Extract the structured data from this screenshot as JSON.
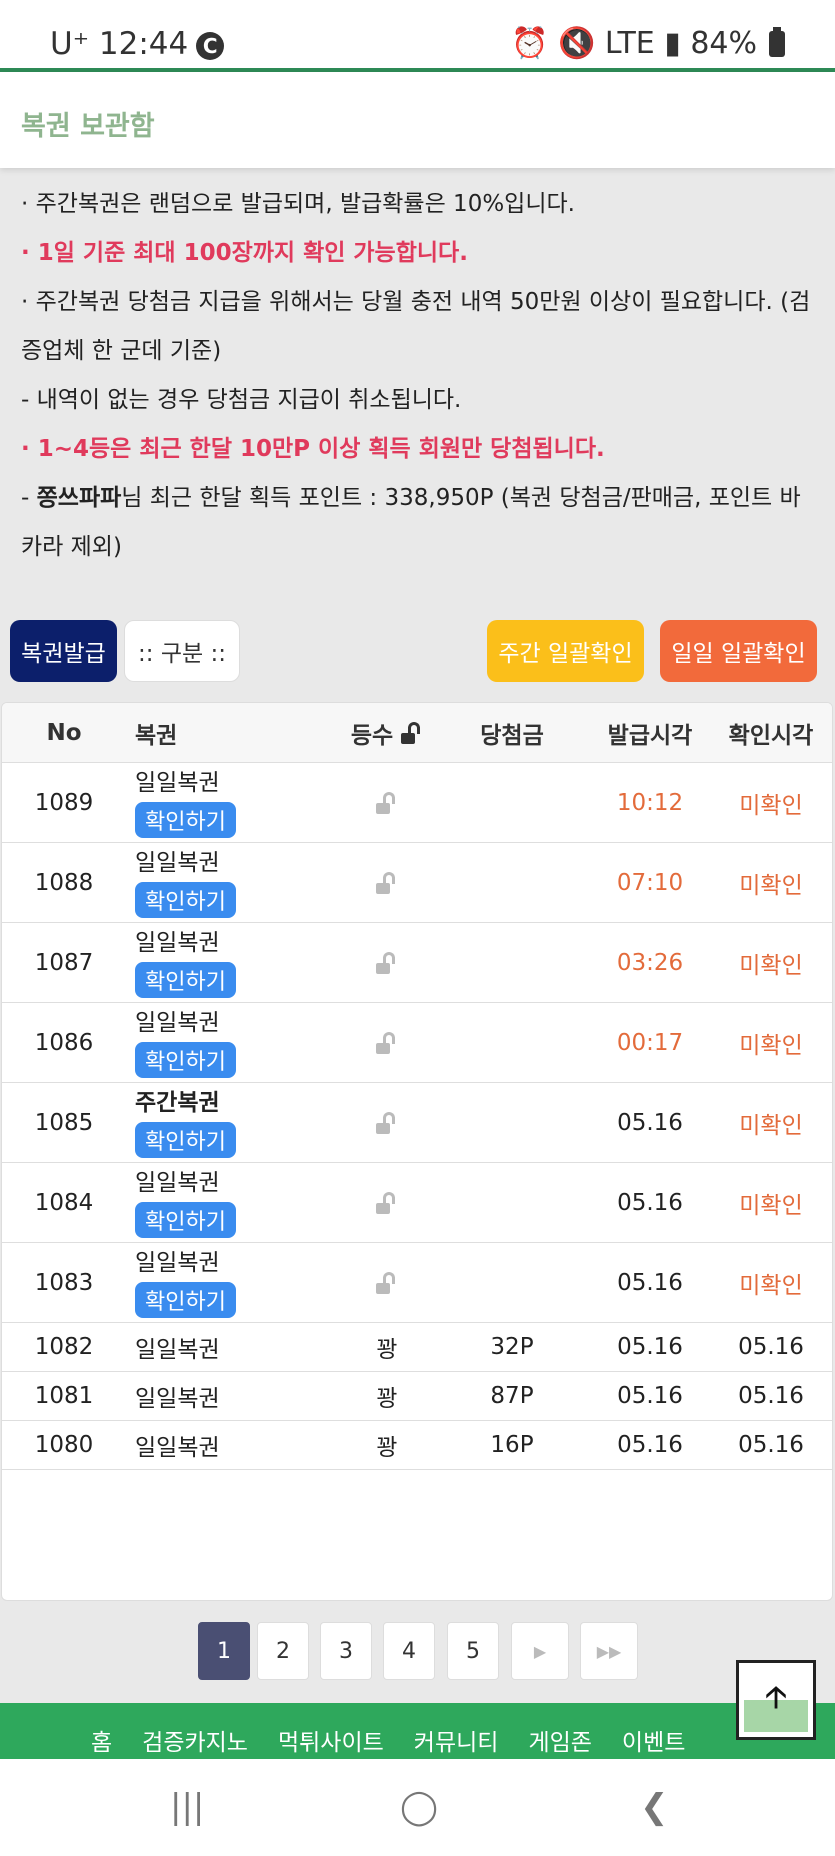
{
  "status": {
    "carrier": "U⁺ 12:44",
    "carrier_badge": "C",
    "right_icons": "⏰ 🔇 LTE ▮ 84%"
  },
  "header": {
    "title": "복권 보관함"
  },
  "notice": {
    "l1": "· 주간복권은 랜덤으로 발급되며, 발급확률은 10%입니다.",
    "l2": "· 1일 기준 최대 100장까지 확인 가능합니다.",
    "l3": "· 주간복권 당첨금 지급을 위해서는 당월 충전 내역 50만원 이상이 필요합니다. (검증업체 한 군데 기준)",
    "l4": " - 내역이 없는 경우 당첨금 지급이 취소됩니다.",
    "l5": "· 1~4등은 최근 한달 10만P 이상 획득 회원만 당첨됩니다.",
    "l6_user": "쫑쓰파파",
    "l6_rest": "님 최근 한달 획득 포인트 : 338,950P (복권 당첨금/판매금, 포인트 바카라 제외)"
  },
  "actions": {
    "issue": "복권발급",
    "category": ":: 구분 ::",
    "weekly_check": "주간 일괄확인",
    "daily_check": "일일 일괄확인"
  },
  "table": {
    "headers": {
      "no": "No",
      "name": "복권",
      "rank": "등수",
      "prize": "당첨금",
      "issued": "발급시각",
      "checked": "확인시각"
    },
    "confirm_label": "확인하기",
    "rows": [
      {
        "no": "1089",
        "name": "일일복권",
        "rank": "",
        "prize": "",
        "issued": "10:12",
        "checked": "미확인"
      },
      {
        "no": "1088",
        "name": "일일복권",
        "rank": "",
        "prize": "",
        "issued": "07:10",
        "checked": "미확인"
      },
      {
        "no": "1087",
        "name": "일일복권",
        "rank": "",
        "prize": "",
        "issued": "03:26",
        "checked": "미확인"
      },
      {
        "no": "1086",
        "name": "일일복권",
        "rank": "",
        "prize": "",
        "issued": "00:17",
        "checked": "미확인"
      },
      {
        "no": "1085",
        "name": "주간복권",
        "rank": "",
        "prize": "",
        "issued": "05.16",
        "checked": "미확인"
      },
      {
        "no": "1084",
        "name": "일일복권",
        "rank": "",
        "prize": "",
        "issued": "05.16",
        "checked": "미확인"
      },
      {
        "no": "1083",
        "name": "일일복권",
        "rank": "",
        "prize": "",
        "issued": "05.16",
        "checked": "미확인"
      },
      {
        "no": "1082",
        "name": "일일복권",
        "rank": "꽝",
        "prize": "32P",
        "issued": "05.16",
        "checked": "05.16"
      },
      {
        "no": "1081",
        "name": "일일복권",
        "rank": "꽝",
        "prize": "87P",
        "issued": "05.16",
        "checked": "05.16"
      },
      {
        "no": "1080",
        "name": "일일복권",
        "rank": "꽝",
        "prize": "16P",
        "issued": "05.16",
        "checked": "05.16"
      }
    ]
  },
  "pagination": {
    "pages": [
      "1",
      "2",
      "3",
      "4",
      "5"
    ],
    "next": "▶",
    "last": "▶▶",
    "active": "1"
  },
  "footer": {
    "nav": [
      "홈",
      "검증카지노",
      "먹튀사이트",
      "커뮤니티",
      "게임존",
      "이벤트"
    ]
  },
  "scroll_top": "🡡",
  "android_nav": {
    "recent": "|||",
    "home": "◯",
    "back": "❮"
  },
  "colors": {
    "accent_green": "#2ea85c",
    "navy": "#0c1f6b",
    "weekly": "#fbbf1a",
    "daily": "#f26a3b",
    "confirm": "#3a8cef",
    "alert": "#e03a5c",
    "time_orange": "#e36b3b"
  }
}
